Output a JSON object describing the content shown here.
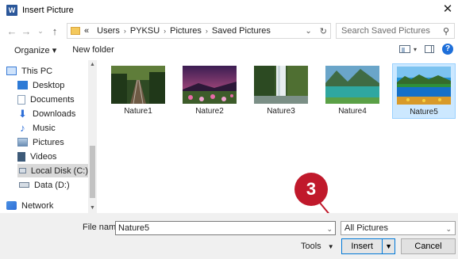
{
  "window": {
    "title": "Insert Picture",
    "app_icon": "W",
    "close_glyph": "✕"
  },
  "nav": {
    "back": "←",
    "forward": "→",
    "recent": "⌄",
    "up": "↑",
    "overflow": "«",
    "breadcrumbs": [
      "Users",
      "PYKSU",
      "Pictures",
      "Saved Pictures"
    ],
    "search_placeholder": "Search Saved Pictures"
  },
  "toolbar": {
    "organize": "Organize ▾",
    "new_folder": "New folder",
    "help": "?"
  },
  "sidebar": {
    "items": [
      {
        "label": "This PC",
        "icon": "computer-icon",
        "color": "#3a7bd5"
      },
      {
        "label": "Desktop",
        "icon": "desktop-icon",
        "color": "#2d7ad6"
      },
      {
        "label": "Documents",
        "icon": "documents-icon",
        "color": "#8aa0b8"
      },
      {
        "label": "Downloads",
        "icon": "downloads-icon",
        "color": "#2f6fd8"
      },
      {
        "label": "Music",
        "icon": "music-icon",
        "color": "#2f6fd8"
      },
      {
        "label": "Pictures",
        "icon": "pictures-icon",
        "color": "#6b8db4"
      },
      {
        "label": "Videos",
        "icon": "videos-icon",
        "color": "#3d5a78"
      },
      {
        "label": "Local Disk (C:)",
        "icon": "drive-c-icon",
        "color": "#6d7f94",
        "selected": true
      },
      {
        "label": "Data (D:)",
        "icon": "drive-d-icon",
        "color": "#6d7f94"
      },
      {
        "label": "Network",
        "icon": "network-icon",
        "color": "#2f6fd8"
      }
    ]
  },
  "files": [
    {
      "name": "Nature1",
      "scene": "railway"
    },
    {
      "name": "Nature2",
      "scene": "sunset-flowers"
    },
    {
      "name": "Nature3",
      "scene": "waterfall"
    },
    {
      "name": "Nature4",
      "scene": "lake"
    },
    {
      "name": "Nature5",
      "scene": "mountain-lake",
      "selected": true
    }
  ],
  "annotation": {
    "step": "3",
    "color": "#c0192b"
  },
  "bottom": {
    "file_name_label": "File name:",
    "file_name_value": "Nature5",
    "filter_value": "All Pictures",
    "tools_label": "Tools",
    "insert_label": "Insert",
    "cancel_label": "Cancel"
  },
  "colors": {
    "accent": "#0078d7",
    "selection": "#cce8ff"
  }
}
